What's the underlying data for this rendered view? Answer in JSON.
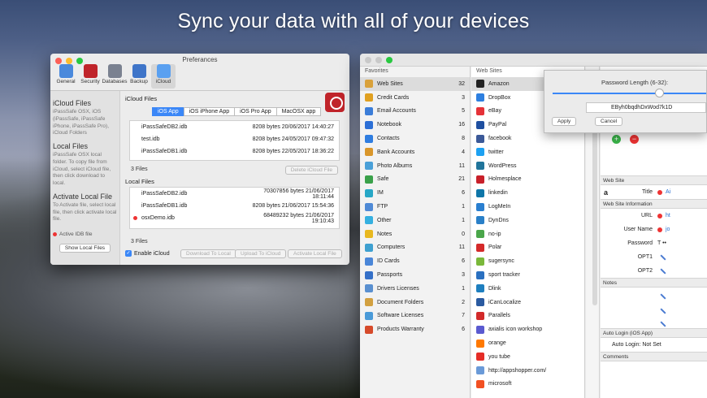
{
  "headline": "Sync your data with all of your devices",
  "pref": {
    "title": "Preferances",
    "toolbar": [
      {
        "label": "General",
        "icon": "general-icon",
        "color": "#4a89dc"
      },
      {
        "label": "Security",
        "icon": "lock-icon",
        "color": "#c0242a"
      },
      {
        "label": "Databases",
        "icon": "database-icon",
        "color": "#7a8190"
      },
      {
        "label": "Backup",
        "icon": "clock-icon",
        "color": "#3f75c9"
      },
      {
        "label": "iCloud",
        "icon": "cloud-icon",
        "color": "#5aa0f0"
      }
    ],
    "side": {
      "h1": "iCloud Files",
      "p1": "iPassSafe OSX, iOS (iPassSafe, iPassSafe iPhone, iPassSafe Pro), iCloud Folders",
      "h2": "Local Files",
      "p2": "iPassSafe OSX local folder. To copy file from iCloud, select iCloud file, then click download to local.",
      "h3": "Activate Local File",
      "p3": "To Activate file, select local file, then click activate local file.",
      "active": "Active IDB file",
      "show_btn": "Show Local Files"
    },
    "icloud_label": "iCloud Files",
    "tabs": [
      "iOS App",
      "iOS iPhone App",
      "iOS Pro App",
      "MacOSX app"
    ],
    "icloud_files": [
      {
        "name": "iPassSafeDB2.idb",
        "meta": "8208 bytes 20/06/2017 14:40:27"
      },
      {
        "name": "test.idb",
        "meta": "8208 bytes 24/05/2017 09:47:32"
      },
      {
        "name": "iPassSafeDB1.idb",
        "meta": "8208 bytes 22/05/2017 18:36:22"
      }
    ],
    "icloud_count": "3 Files",
    "delete_btn": "Delete iCloud File",
    "local_label": "Local Files",
    "local_files": [
      {
        "name": "iPassSafeDB2.idb",
        "meta": "70307856 bytes 21/06/2017 18:11:44"
      },
      {
        "name": "iPassSafeDB1.idb",
        "meta": "8208 bytes 21/06/2017 15:54:36"
      },
      {
        "name": "osxDemo.idb",
        "meta": "68489232 bytes 21/06/2017 19:10:43"
      }
    ],
    "local_count": "3 Files",
    "enable_icloud": "Enable iCloud",
    "btn_download": "Download To Local",
    "btn_upload": "Upload To iCloud",
    "btn_activate": "Activate Local File"
  },
  "app": {
    "fav_header": "Favorites",
    "favorites": [
      {
        "name": "Web Sites",
        "n": "32",
        "c": "#d9a13a"
      },
      {
        "name": "Credit Cards",
        "n": "3",
        "c": "#e0a020"
      },
      {
        "name": "Email Accounts",
        "n": "5",
        "c": "#3b7dd8"
      },
      {
        "name": "Notebook",
        "n": "16",
        "c": "#2c6fd6"
      },
      {
        "name": "Contacts",
        "n": "8",
        "c": "#2f7de0"
      },
      {
        "name": "Bank Accounts",
        "n": "4",
        "c": "#d9962a"
      },
      {
        "name": "Photo Albums",
        "n": "11",
        "c": "#4aa0d8"
      },
      {
        "name": "Safe",
        "n": "21",
        "c": "#3aa14a"
      },
      {
        "name": "IM",
        "n": "6",
        "c": "#27a7c6"
      },
      {
        "name": "FTP",
        "n": "1",
        "c": "#4f8ad6"
      },
      {
        "name": "Other",
        "n": "1",
        "c": "#35b0e0"
      },
      {
        "name": "Notes",
        "n": "0",
        "c": "#e8b820"
      },
      {
        "name": "Computers",
        "n": "11",
        "c": "#3ea0d0"
      },
      {
        "name": "ID Cards",
        "n": "6",
        "c": "#4a86d8"
      },
      {
        "name": "Passports",
        "n": "3",
        "c": "#3570c8"
      },
      {
        "name": "Drivers Licenses",
        "n": "1",
        "c": "#5a90d0"
      },
      {
        "name": "Document Folders",
        "n": "2",
        "c": "#d2a040"
      },
      {
        "name": "Software Licenses",
        "n": "7",
        "c": "#4a9ad8"
      },
      {
        "name": "Products Warranty",
        "n": "6",
        "c": "#d64a2a"
      }
    ],
    "sites_header": "Web Sites",
    "sites": [
      {
        "name": "Amazon",
        "c": "#222"
      },
      {
        "name": "DropBox",
        "c": "#2d7fe0"
      },
      {
        "name": "eBay",
        "c": "#e53238"
      },
      {
        "name": "PayPal",
        "c": "#1f4fa0"
      },
      {
        "name": "facebook",
        "c": "#3b5998"
      },
      {
        "name": "twitter",
        "c": "#1da1f2"
      },
      {
        "name": "WordPress",
        "c": "#21759b"
      },
      {
        "name": "Holmesplace",
        "c": "#c8202a"
      },
      {
        "name": "linkedin",
        "c": "#0e76a8"
      },
      {
        "name": "LogMeIn",
        "c": "#2a7fd0"
      },
      {
        "name": "DynDns",
        "c": "#2a80c8"
      },
      {
        "name": "no-ip",
        "c": "#4aa64a"
      },
      {
        "name": "Polar",
        "c": "#d42a2a"
      },
      {
        "name": "sugersync",
        "c": "#7ab83a"
      },
      {
        "name": "sport tracker",
        "c": "#2a70c0"
      },
      {
        "name": "Dlink",
        "c": "#1e7fbf"
      },
      {
        "name": "iCanLocalize",
        "c": "#2a5aa0"
      },
      {
        "name": "Parallels",
        "c": "#d22a2a"
      },
      {
        "name": "axialis icon workshop",
        "c": "#5a5ad0"
      },
      {
        "name": "orange",
        "c": "#ff7900"
      },
      {
        "name": "you tube",
        "c": "#e52d27"
      },
      {
        "name": "http://appshopper.com/",
        "c": "#6a9ad8"
      },
      {
        "name": "microsoft",
        "c": "#f25022"
      }
    ],
    "detail": {
      "sec1": "Web Site",
      "title_label": "Title",
      "title_val": "Ai",
      "sec2": "Web Site Information",
      "url_label": "URL",
      "url_val": "ht",
      "user_label": "User Name",
      "user_val": "jo",
      "pass_label": "Password",
      "pass_val": "T ••",
      "opt1": "OPT1",
      "opt2": "OPT2",
      "notes": "Notes",
      "auto_sec": "Auto Login (iOS App)",
      "auto_val": "Auto Login: Not Set",
      "comments": "Comments"
    }
  },
  "popup": {
    "title": "Password Length (6-32):",
    "password": "EByh0bqdhDxWod7k1D",
    "apply": "Apply",
    "cancel": "Cancel"
  }
}
